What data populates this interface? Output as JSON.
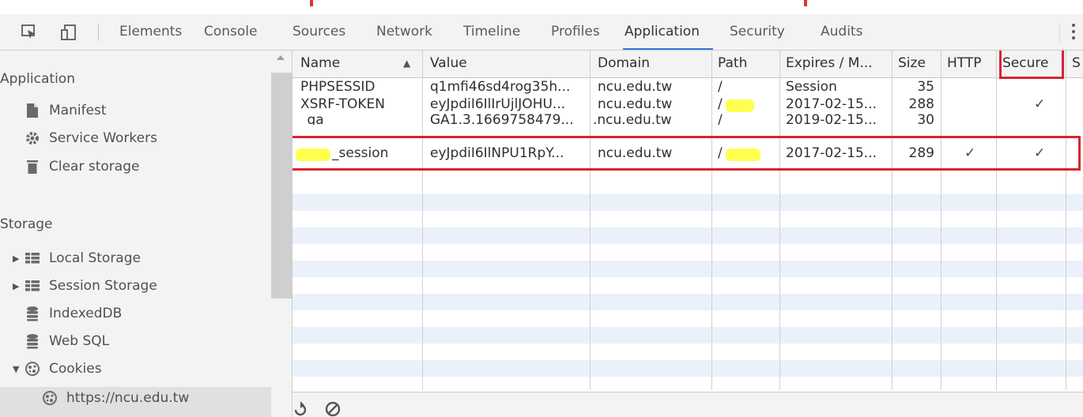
{
  "toolbar": {
    "tabs": [
      "Elements",
      "Console",
      "Sources",
      "Network",
      "Timeline",
      "Profiles",
      "Application",
      "Security",
      "Audits"
    ],
    "active_tab": "Application",
    "more_icon": "kebab-icon"
  },
  "sidebar": {
    "application_header": "Application",
    "application_items": [
      {
        "label": "Manifest",
        "icon": "manifest-icon"
      },
      {
        "label": "Service Workers",
        "icon": "gear-icon"
      },
      {
        "label": "Clear storage",
        "icon": "trash-icon"
      }
    ],
    "storage_header": "Storage",
    "storage_items": [
      {
        "label": "Local Storage",
        "icon": "table-icon",
        "expand": "▶"
      },
      {
        "label": "Session Storage",
        "icon": "table-icon",
        "expand": "▶"
      },
      {
        "label": "IndexedDB",
        "icon": "database-icon"
      },
      {
        "label": "Web SQL",
        "icon": "database-icon"
      },
      {
        "label": "Cookies",
        "icon": "cookie-icon",
        "expand": "▼"
      },
      {
        "label": "https://ncu.edu.tw",
        "icon": "cookie-icon"
      }
    ]
  },
  "table": {
    "columns": [
      "Name",
      "Value",
      "Domain",
      "Path",
      "Expires / M...",
      "Size",
      "HTTP",
      "Secure",
      "S"
    ],
    "sort_indicator": "▲",
    "rows": [
      {
        "name": "PHPSESSID",
        "value": "q1mfi46sd4rog35h...",
        "domain": "ncu.edu.tw",
        "path": "/",
        "expires": "Session",
        "size": "35",
        "http": "",
        "secure": ""
      },
      {
        "name": "XSRF-TOKEN",
        "value": "eyJpdiI6IlIrUjlJOHU...",
        "domain": "ncu.edu.tw",
        "path": "/",
        "expires": "2017-02-15...",
        "size": "288",
        "http": "",
        "secure": "✓"
      },
      {
        "name": "_ga",
        "value": "GA1.3.1669758479...",
        "domain": ".ncu.edu.tw",
        "path": "/",
        "expires": "2019-02-15...",
        "size": "30",
        "http": "",
        "secure": ""
      },
      {
        "name": "_session",
        "value": "eyJpdiI6IlNPU1RpY...",
        "domain": "ncu.edu.tw",
        "path": "/",
        "expires": "2017-02-15...",
        "size": "289",
        "http": "✓",
        "secure": "✓"
      }
    ],
    "footer_icons": [
      "refresh-icon",
      "clear-icon"
    ]
  },
  "colors": {
    "highlight": "#d9242f",
    "stripe": "#eaf1fb",
    "redaction": "#ffff3c",
    "tab_underline": "#3879d9"
  }
}
